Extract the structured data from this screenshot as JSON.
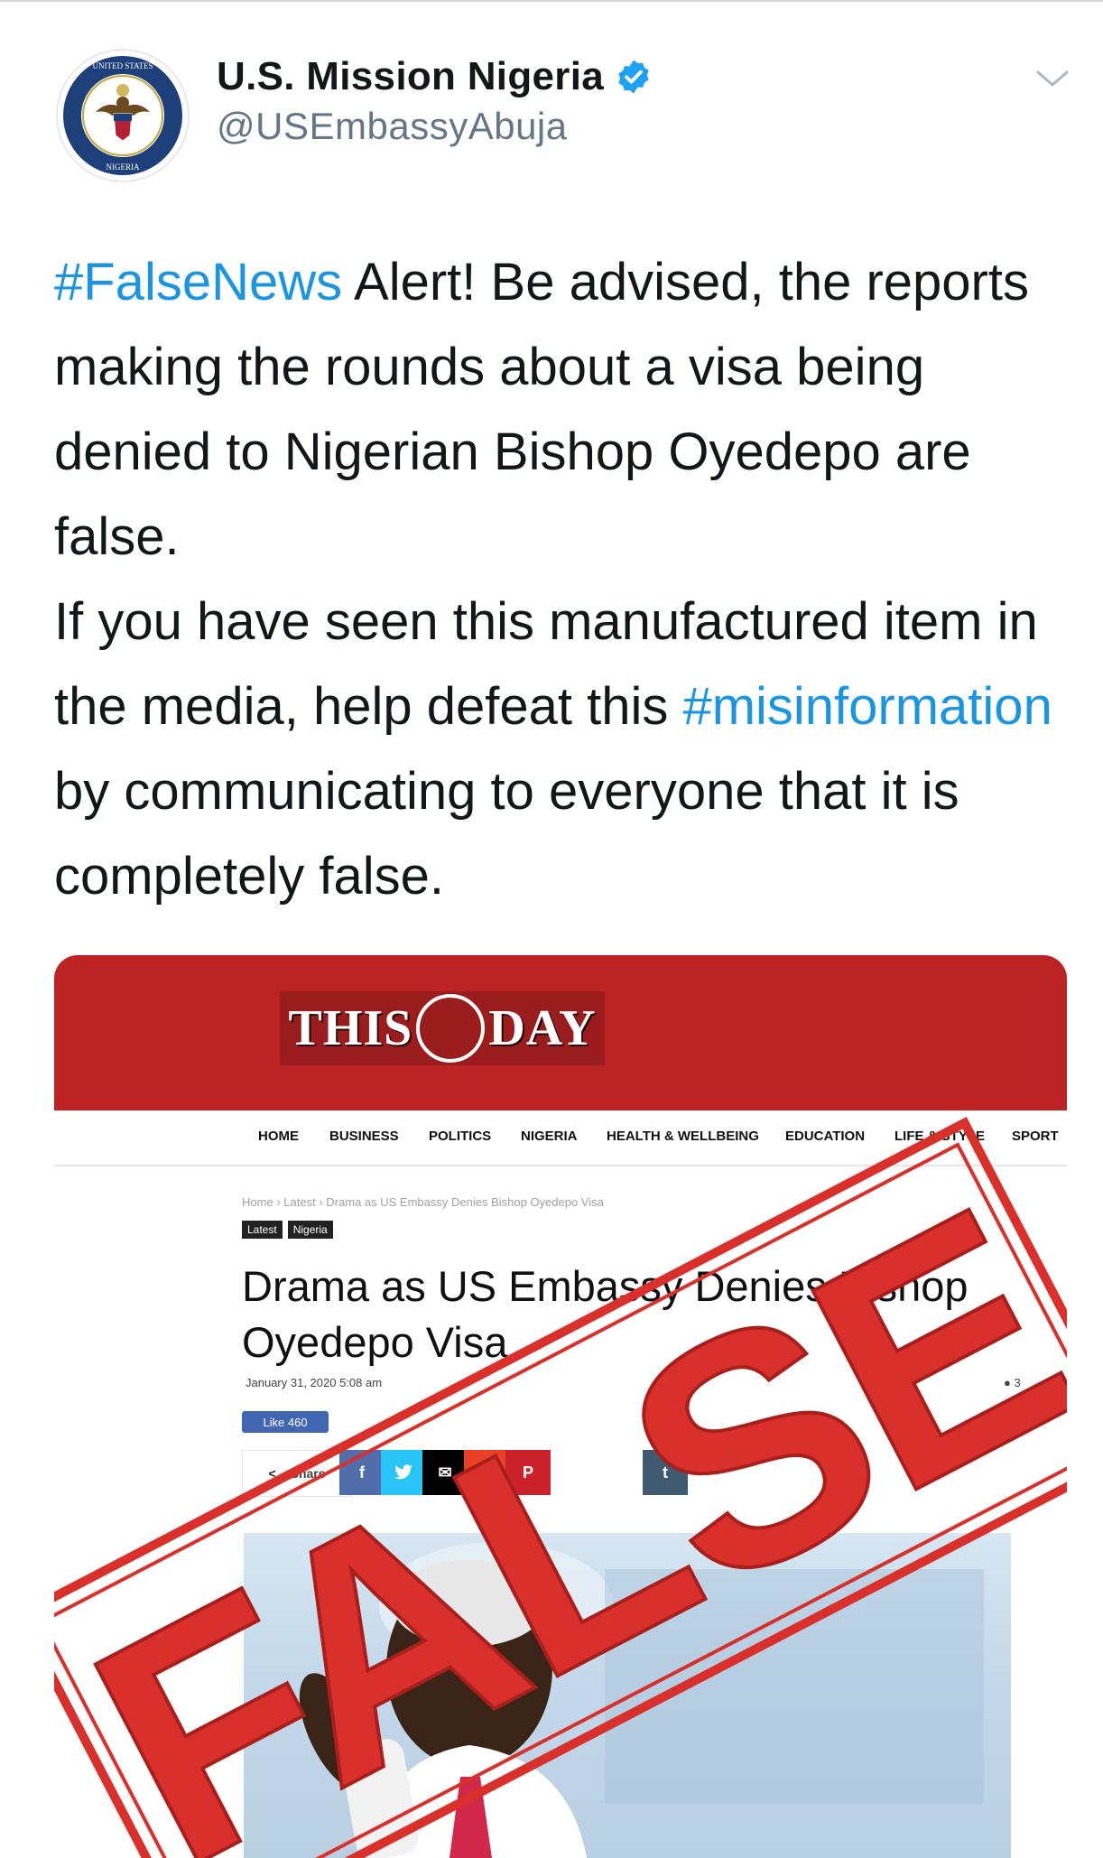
{
  "account": {
    "name": "U.S. Mission Nigeria",
    "handle": "@USEmbassyAbuja",
    "verified": true,
    "avatar_icon": "embassy-seal-icon"
  },
  "tweet": {
    "hashtag1": "#FalseNews",
    "part1": " Alert! Be advised, the reports making the rounds about a visa being denied to Nigerian Bishop Oyedepo are false.",
    "part2": "If you have seen this manufactured item in the media, help defeat this ",
    "hashtag2": "#misinformation",
    "part3": " by communicating to everyone that it is completely false."
  },
  "card": {
    "masthead": {
      "left": "THIS",
      "right": "DAY"
    },
    "nav": [
      "HOME",
      "BUSINESS",
      "POLITICS",
      "NIGERIA",
      "HEALTH & WELLBEING",
      "EDUCATION",
      "LIFE & STYLE",
      "SPORT"
    ],
    "breadcrumb": {
      "home": "Home",
      "sep": "›",
      "latest": "Latest",
      "current": "Drama as US Embassy Denies Bishop Oyedepo Visa"
    },
    "tags": [
      "Latest",
      "Nigeria"
    ],
    "headline": "Drama as US Embassy Denies Bishop Oyedepo Visa",
    "date": "January 31, 2020 5:08 am",
    "comment_count": "3",
    "like_label": "Like 460",
    "share_label": "Share",
    "social_buttons": [
      {
        "icon": "f",
        "name": "facebook",
        "color": "#516eab"
      },
      {
        "icon": "t",
        "name": "twitter",
        "color": "#29c5f6"
      },
      {
        "icon": "✉",
        "name": "email",
        "color": "#000000"
      },
      {
        "icon": "G+",
        "name": "google-plus",
        "color": "#eb4026"
      },
      {
        "icon": "P",
        "name": "pinterest",
        "color": "#ca212a"
      },
      {
        "icon": "t",
        "name": "tumblr",
        "color": "#3e5a70"
      }
    ],
    "stamp_text": "FALSE"
  },
  "colors": {
    "hashtag": "#1b95e0",
    "masthead": "#bb2324",
    "stamp": "#d9302c",
    "handle": "#657786"
  }
}
